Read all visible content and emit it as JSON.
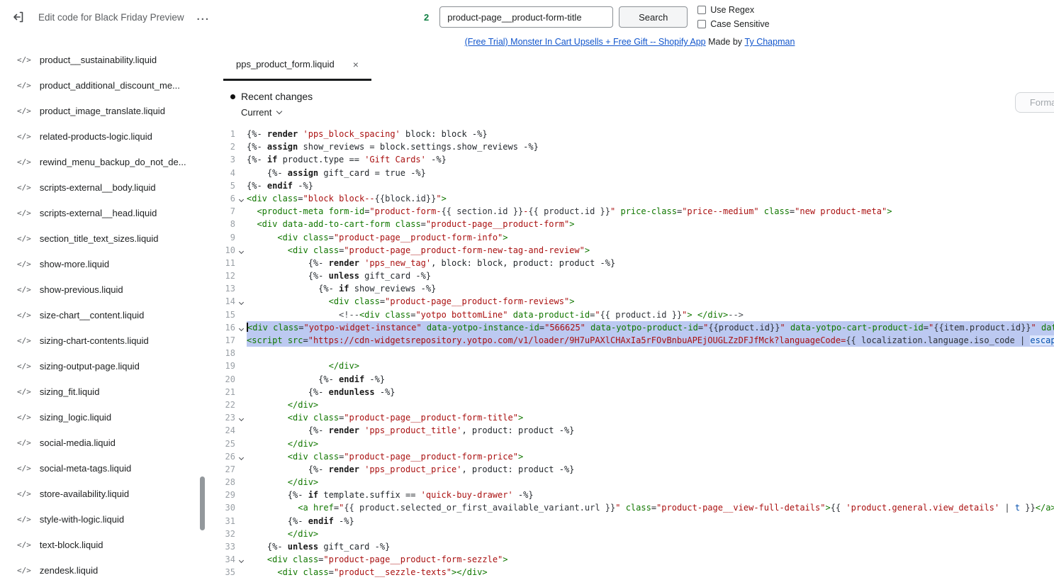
{
  "header": {
    "title": "Edit code for Black Friday Preview",
    "overflow_menu": "...",
    "search": {
      "count": "2",
      "query": "product-page__product-form-title",
      "button": "Search",
      "use_regex_label": "Use Regex",
      "case_sensitive_label": "Case Sensitive"
    }
  },
  "banner": {
    "link1": "(Free Trial) Monster In Cart Upsells + Free Gift -- Shopify App",
    "middle": " Made by ",
    "link2": "Ty Chapman"
  },
  "sidebar": {
    "files": [
      "product__sustainability.liquid",
      "product_additional_discount_me...",
      "product_image_translate.liquid",
      "related-products-logic.liquid",
      "rewind_menu_backup_do_not_de...",
      "scripts-external__body.liquid",
      "scripts-external__head.liquid",
      "section_title_text_sizes.liquid",
      "show-more.liquid",
      "show-previous.liquid",
      "size-chart__content.liquid",
      "sizing-chart-contents.liquid",
      "sizing-output-page.liquid",
      "sizing_fit.liquid",
      "sizing_logic.liquid",
      "social-media.liquid",
      "social-meta-tags.liquid",
      "store-availability.liquid",
      "style-with-logic.liquid",
      "text-block.liquid",
      "zendesk.liquid"
    ],
    "file_icon": "</>"
  },
  "editor": {
    "tab": {
      "label": "pps_product_form.liquid",
      "close": "×"
    },
    "recent_changes": "Recent changes",
    "version": "Current",
    "format_button": "Format",
    "lines": [
      {
        "n": 1,
        "fold": false,
        "sel": false,
        "tk": [
          [
            "d",
            "{%- "
          ],
          [
            "k",
            "render"
          ],
          [
            "d",
            " "
          ],
          [
            "s",
            "'pps_block_spacing'"
          ],
          [
            "d",
            " block: block -%}"
          ]
        ]
      },
      {
        "n": 2,
        "fold": false,
        "sel": false,
        "tk": [
          [
            "d",
            "{%- "
          ],
          [
            "k",
            "assign"
          ],
          [
            "d",
            " show_reviews = block.settings.show_reviews -%}"
          ]
        ]
      },
      {
        "n": 3,
        "fold": false,
        "sel": false,
        "tk": [
          [
            "d",
            "{%- "
          ],
          [
            "k",
            "if"
          ],
          [
            "d",
            " product.type == "
          ],
          [
            "s",
            "'Gift Cards'"
          ],
          [
            "d",
            " -%}"
          ]
        ]
      },
      {
        "n": 4,
        "fold": false,
        "sel": false,
        "tk": [
          [
            "d",
            "    {%- "
          ],
          [
            "k",
            "assign"
          ],
          [
            "d",
            " gift_card = true -%}"
          ]
        ]
      },
      {
        "n": 5,
        "fold": false,
        "sel": false,
        "tk": [
          [
            "d",
            "{%- "
          ],
          [
            "k",
            "endif"
          ],
          [
            "d",
            " -%}"
          ]
        ]
      },
      {
        "n": 6,
        "fold": true,
        "sel": false,
        "tk": [
          [
            "t",
            "<div"
          ],
          [
            "d",
            " "
          ],
          [
            "t",
            "class"
          ],
          [
            "d",
            "="
          ],
          [
            "s",
            "\"block block--"
          ],
          [
            "v",
            "{{block.id}}"
          ],
          [
            "s",
            "\""
          ],
          [
            "t",
            ">"
          ]
        ]
      },
      {
        "n": 7,
        "fold": false,
        "sel": false,
        "tk": [
          [
            "d",
            "  "
          ],
          [
            "t",
            "<product-meta"
          ],
          [
            "d",
            " "
          ],
          [
            "t",
            "form-id"
          ],
          [
            "d",
            "="
          ],
          [
            "s",
            "\"product-form-"
          ],
          [
            "v",
            "{{ section.id }}"
          ],
          [
            "s",
            "-"
          ],
          [
            "v",
            "{{ product.id }}"
          ],
          [
            "s",
            "\""
          ],
          [
            "d",
            " "
          ],
          [
            "t",
            "price-class"
          ],
          [
            "d",
            "="
          ],
          [
            "s",
            "\"price--medium\""
          ],
          [
            "d",
            " "
          ],
          [
            "t",
            "class"
          ],
          [
            "d",
            "="
          ],
          [
            "s",
            "\"new product-meta\""
          ],
          [
            "t",
            ">"
          ]
        ]
      },
      {
        "n": 8,
        "fold": false,
        "sel": false,
        "tk": [
          [
            "d",
            "  "
          ],
          [
            "t",
            "<div"
          ],
          [
            "d",
            " "
          ],
          [
            "t",
            "data-add-to-cart-form"
          ],
          [
            "d",
            " "
          ],
          [
            "t",
            "class"
          ],
          [
            "d",
            "="
          ],
          [
            "s",
            "\"product-page__product-form\""
          ],
          [
            "t",
            ">"
          ]
        ]
      },
      {
        "n": 9,
        "fold": false,
        "sel": false,
        "tk": [
          [
            "d",
            "      "
          ],
          [
            "t",
            "<div"
          ],
          [
            "d",
            " "
          ],
          [
            "t",
            "class"
          ],
          [
            "d",
            "="
          ],
          [
            "s",
            "\"product-page__product-form-info\""
          ],
          [
            "t",
            ">"
          ]
        ]
      },
      {
        "n": 10,
        "fold": true,
        "sel": false,
        "tk": [
          [
            "d",
            "        "
          ],
          [
            "t",
            "<div"
          ],
          [
            "d",
            " "
          ],
          [
            "t",
            "class"
          ],
          [
            "d",
            "="
          ],
          [
            "s",
            "\"product-page__product-form-new-tag-and-review\""
          ],
          [
            "t",
            ">"
          ]
        ]
      },
      {
        "n": 11,
        "fold": false,
        "sel": false,
        "tk": [
          [
            "d",
            "            {%- "
          ],
          [
            "k",
            "render"
          ],
          [
            "d",
            " "
          ],
          [
            "s",
            "'pps_new_tag'"
          ],
          [
            "d",
            ", block: block, product: product -%}"
          ]
        ]
      },
      {
        "n": 12,
        "fold": false,
        "sel": false,
        "tk": [
          [
            "d",
            "            {%- "
          ],
          [
            "k",
            "unless"
          ],
          [
            "d",
            " gift_card -%}"
          ]
        ]
      },
      {
        "n": 13,
        "fold": false,
        "sel": false,
        "tk": [
          [
            "d",
            "              {%- "
          ],
          [
            "k",
            "if"
          ],
          [
            "d",
            " show_reviews -%}"
          ]
        ]
      },
      {
        "n": 14,
        "fold": true,
        "sel": false,
        "tk": [
          [
            "d",
            "                "
          ],
          [
            "t",
            "<div"
          ],
          [
            "d",
            " "
          ],
          [
            "t",
            "class"
          ],
          [
            "d",
            "="
          ],
          [
            "s",
            "\"product-page__product-form-reviews\""
          ],
          [
            "t",
            ">"
          ]
        ]
      },
      {
        "n": 15,
        "fold": false,
        "sel": false,
        "tk": [
          [
            "d",
            "                  "
          ],
          [
            "c",
            "<!--"
          ],
          [
            "t",
            "<div"
          ],
          [
            "d",
            " "
          ],
          [
            "t",
            "class"
          ],
          [
            "d",
            "="
          ],
          [
            "s",
            "\"yotpo bottomLine\""
          ],
          [
            "d",
            " "
          ],
          [
            "t",
            "data-product-id"
          ],
          [
            "d",
            "="
          ],
          [
            "s",
            "\""
          ],
          [
            "v",
            "{{ product.id }}"
          ],
          [
            "s",
            "\""
          ],
          [
            "t",
            ">"
          ],
          [
            "d",
            " "
          ],
          [
            "t",
            "</div>"
          ],
          [
            "c",
            "-->"
          ]
        ]
      },
      {
        "n": 16,
        "fold": true,
        "sel": true,
        "caret": true,
        "tk": [
          [
            "t",
            "<div"
          ],
          [
            "d",
            " "
          ],
          [
            "t",
            "class"
          ],
          [
            "d",
            "="
          ],
          [
            "s",
            "\"yotpo-widget-instance\""
          ],
          [
            "d",
            " "
          ],
          [
            "t",
            "data-yotpo-instance-id"
          ],
          [
            "d",
            "="
          ],
          [
            "s",
            "\"566625\""
          ],
          [
            "d",
            " "
          ],
          [
            "t",
            "data-yotpo-product-id"
          ],
          [
            "d",
            "="
          ],
          [
            "s",
            "\""
          ],
          [
            "v",
            "{{product.id}}"
          ],
          [
            "s",
            "\""
          ],
          [
            "d",
            " "
          ],
          [
            "t",
            "data-yotpo-cart-product-id"
          ],
          [
            "d",
            "="
          ],
          [
            "s",
            "\""
          ],
          [
            "v",
            "{{item.product.id}}"
          ],
          [
            "s",
            "\""
          ],
          [
            "d",
            " "
          ],
          [
            "t",
            "data-yotpo"
          ]
        ]
      },
      {
        "n": 17,
        "fold": false,
        "sel": true,
        "tk": [
          [
            "t",
            "<script"
          ],
          [
            "d",
            " "
          ],
          [
            "t",
            "src"
          ],
          [
            "d",
            "="
          ],
          [
            "s",
            "\"https://cdn-widgetsrepository.yotpo.com/v1/loader/9H7uPAXlCHAxIa5rFOvBnbuAPEjOUGLZzDFJfMck?languageCode="
          ],
          [
            "v",
            "{{ localization.language.iso_code | "
          ],
          [
            "f",
            "escape"
          ]
        ]
      },
      {
        "n": 18,
        "fold": false,
        "sel": false,
        "tk": []
      },
      {
        "n": 19,
        "fold": false,
        "sel": false,
        "tk": [
          [
            "d",
            "                "
          ],
          [
            "t",
            "</div>"
          ]
        ]
      },
      {
        "n": 20,
        "fold": false,
        "sel": false,
        "tk": [
          [
            "d",
            "              {%- "
          ],
          [
            "k",
            "endif"
          ],
          [
            "d",
            " -%}"
          ]
        ]
      },
      {
        "n": 21,
        "fold": false,
        "sel": false,
        "tk": [
          [
            "d",
            "            {%- "
          ],
          [
            "k",
            "endunless"
          ],
          [
            "d",
            " -%}"
          ]
        ]
      },
      {
        "n": 22,
        "fold": false,
        "sel": false,
        "tk": [
          [
            "d",
            "        "
          ],
          [
            "t",
            "</div>"
          ]
        ]
      },
      {
        "n": 23,
        "fold": true,
        "sel": false,
        "tk": [
          [
            "d",
            "        "
          ],
          [
            "t",
            "<div"
          ],
          [
            "d",
            " "
          ],
          [
            "t",
            "class"
          ],
          [
            "d",
            "="
          ],
          [
            "s",
            "\"product-page__product-form-title\""
          ],
          [
            "t",
            ">"
          ]
        ]
      },
      {
        "n": 24,
        "fold": false,
        "sel": false,
        "tk": [
          [
            "d",
            "            {%- "
          ],
          [
            "k",
            "render"
          ],
          [
            "d",
            " "
          ],
          [
            "s",
            "'pps_product_title'"
          ],
          [
            "d",
            ", product: product -%}"
          ]
        ]
      },
      {
        "n": 25,
        "fold": false,
        "sel": false,
        "tk": [
          [
            "d",
            "        "
          ],
          [
            "t",
            "</div>"
          ]
        ]
      },
      {
        "n": 26,
        "fold": true,
        "sel": false,
        "tk": [
          [
            "d",
            "        "
          ],
          [
            "t",
            "<div"
          ],
          [
            "d",
            " "
          ],
          [
            "t",
            "class"
          ],
          [
            "d",
            "="
          ],
          [
            "s",
            "\"product-page__product-form-price\""
          ],
          [
            "t",
            ">"
          ]
        ]
      },
      {
        "n": 27,
        "fold": false,
        "sel": false,
        "tk": [
          [
            "d",
            "            {%- "
          ],
          [
            "k",
            "render"
          ],
          [
            "d",
            " "
          ],
          [
            "s",
            "'pps_product_price'"
          ],
          [
            "d",
            ", product: product -%}"
          ]
        ]
      },
      {
        "n": 28,
        "fold": false,
        "sel": false,
        "tk": [
          [
            "d",
            "        "
          ],
          [
            "t",
            "</div>"
          ]
        ]
      },
      {
        "n": 29,
        "fold": false,
        "sel": false,
        "tk": [
          [
            "d",
            "        {%- "
          ],
          [
            "k",
            "if"
          ],
          [
            "d",
            " template.suffix == "
          ],
          [
            "s",
            "'quick-buy-drawer'"
          ],
          [
            "d",
            " -%}"
          ]
        ]
      },
      {
        "n": 30,
        "fold": false,
        "sel": false,
        "tk": [
          [
            "d",
            "          "
          ],
          [
            "t",
            "<a"
          ],
          [
            "d",
            " "
          ],
          [
            "t",
            "href"
          ],
          [
            "d",
            "="
          ],
          [
            "s",
            "\""
          ],
          [
            "v",
            "{{ product.selected_or_first_available_variant.url }}"
          ],
          [
            "s",
            "\""
          ],
          [
            "d",
            " "
          ],
          [
            "t",
            "class"
          ],
          [
            "d",
            "="
          ],
          [
            "s",
            "\"product-page__view-full-details\""
          ],
          [
            "t",
            ">"
          ],
          [
            "v",
            "{{ "
          ],
          [
            "s",
            "'product.general.view_details'"
          ],
          [
            "v",
            " | "
          ],
          [
            "f",
            "t"
          ],
          [
            "v",
            " }}"
          ],
          [
            "t",
            "</a>"
          ]
        ]
      },
      {
        "n": 31,
        "fold": false,
        "sel": false,
        "tk": [
          [
            "d",
            "        {%- "
          ],
          [
            "k",
            "endif"
          ],
          [
            "d",
            " -%}"
          ]
        ]
      },
      {
        "n": 32,
        "fold": false,
        "sel": false,
        "tk": [
          [
            "d",
            "        "
          ],
          [
            "t",
            "</div>"
          ]
        ]
      },
      {
        "n": 33,
        "fold": false,
        "sel": false,
        "tk": [
          [
            "d",
            "    {%- "
          ],
          [
            "k",
            "unless"
          ],
          [
            "d",
            " gift_card -%}"
          ]
        ]
      },
      {
        "n": 34,
        "fold": true,
        "sel": false,
        "tk": [
          [
            "d",
            "    "
          ],
          [
            "t",
            "<div"
          ],
          [
            "d",
            " "
          ],
          [
            "t",
            "class"
          ],
          [
            "d",
            "="
          ],
          [
            "s",
            "\"product-page__product-form-sezzle\""
          ],
          [
            "t",
            ">"
          ]
        ]
      },
      {
        "n": 35,
        "fold": false,
        "sel": false,
        "tk": [
          [
            "d",
            "      "
          ],
          [
            "t",
            "<div"
          ],
          [
            "d",
            " "
          ],
          [
            "t",
            "class"
          ],
          [
            "d",
            "="
          ],
          [
            "s",
            "\"product__sezzle-texts\""
          ],
          [
            "t",
            ">"
          ],
          [
            "t",
            "</div>"
          ]
        ]
      }
    ]
  },
  "colors": {
    "link_blue": "#1155cc",
    "match_count_green": "#108043",
    "selection_blue": "#bcc9f1",
    "tag_green": "#117700",
    "string_red": "#aa1111",
    "filter_blue": "#0550ae",
    "active_tab_underline": "#1a1c1d"
  }
}
